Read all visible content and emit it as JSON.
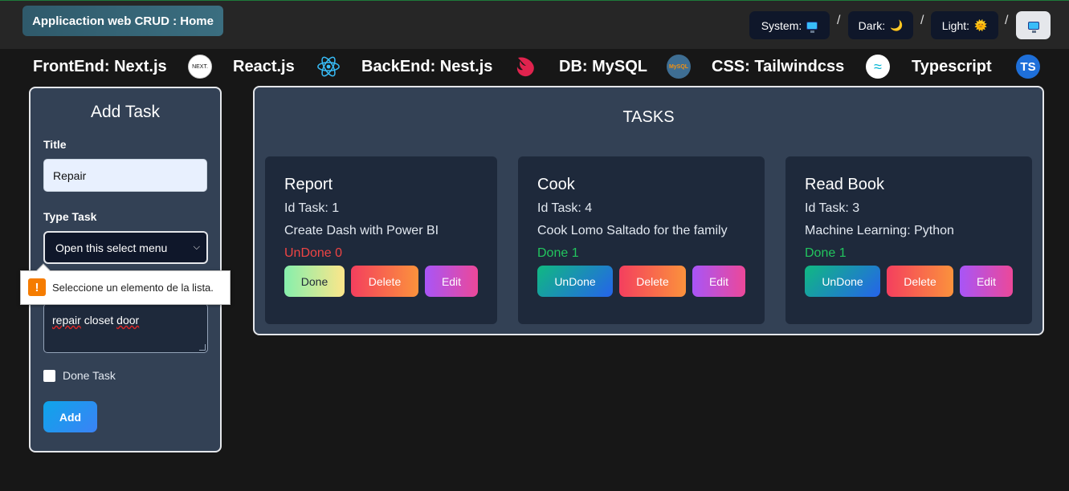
{
  "header": {
    "app_title": "Applicaction web CRUD : Home",
    "theme": {
      "system_label": "System:",
      "dark_label": "Dark:",
      "light_label": "Light:",
      "separator": "/",
      "dark_icon": "🌙",
      "light_icon": "🌞"
    }
  },
  "tech_stack": [
    {
      "label": "FrontEnd: Next.js",
      "icon": "nextjs-logo",
      "icon_text": "NEXT."
    },
    {
      "label": "React.js",
      "icon": "react-logo"
    },
    {
      "label": "BackEnd: Nest.js",
      "icon": "nestjs-logo"
    },
    {
      "label": "DB: MySQL",
      "icon": "mysql-logo",
      "icon_text": "MySQL"
    },
    {
      "label": "CSS: Tailwindcss",
      "icon": "tailwind-logo",
      "icon_text": "≈"
    },
    {
      "label": "Typescript",
      "icon": "typescript-logo",
      "icon_text": "TS"
    }
  ],
  "add_form": {
    "heading": "Add Task",
    "title_label": "Title",
    "title_value": "Repair",
    "type_label": "Type Task",
    "type_select_value": "Open this select menu",
    "description_value": "repair closet door",
    "done_label": "Done Task",
    "submit_label": "Add",
    "validation_tooltip": "Seleccione un elemento de la lista.",
    "warning_glyph": "!"
  },
  "tasks": {
    "heading": "TASKS",
    "id_prefix": "Id Task:",
    "items": [
      {
        "title": "Report",
        "id_text": "Id Task: 1",
        "description": "Create Dash with Power BI",
        "status_text": "UnDone 0",
        "status_color": "#ef4444",
        "toggle_label": "Done",
        "delete_label": "Delete",
        "edit_label": "Edit"
      },
      {
        "title": "Cook",
        "id_text": "Id Task: 4",
        "description": "Cook Lomo Saltado for the family",
        "status_text": "Done 1",
        "status_color": "#22c55e",
        "toggle_label": "UnDone",
        "delete_label": "Delete",
        "edit_label": "Edit"
      },
      {
        "title": "Read Book",
        "id_text": "Id Task: 3",
        "description": "Machine Learning: Python",
        "status_text": "Done 1",
        "status_color": "#22c55e",
        "toggle_label": "UnDone",
        "delete_label": "Delete",
        "edit_label": "Edit"
      }
    ]
  },
  "colors": {
    "background": "#171717",
    "panel": "#334155",
    "card": "#1e293b",
    "undone": "#ef4444",
    "done": "#22c55e"
  }
}
